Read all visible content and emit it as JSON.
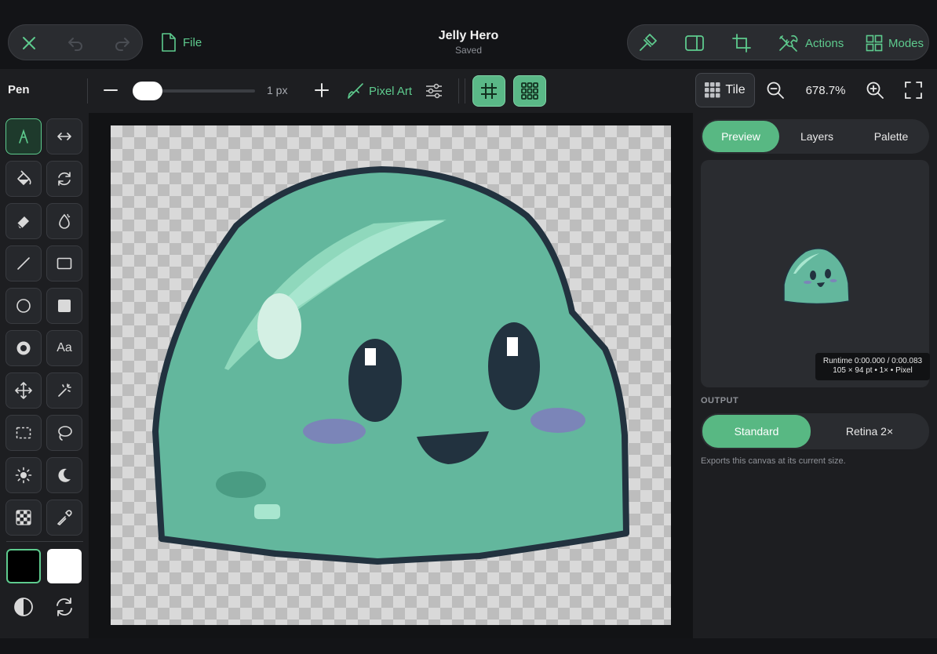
{
  "header": {
    "file_label": "File",
    "doc_title": "Jelly Hero",
    "doc_status": "Saved",
    "actions_label": "Actions",
    "modes_label": "Modes"
  },
  "toolbar": {
    "tool_name": "Pen",
    "brush_size": "1 px",
    "brush_size_value": 1,
    "brush_mode": "Pixel Art",
    "tile_label": "Tile",
    "zoom": "678.7%"
  },
  "tools": [
    "pen-icon",
    "flip-horizontal-icon",
    "fill-bucket-icon",
    "rotate-icon",
    "eraser-icon",
    "blur-drop-icon",
    "line-icon",
    "rectangle-icon",
    "ellipse-icon",
    "filled-square-icon",
    "radial-icon",
    "text-icon",
    "move-icon",
    "magic-wand-icon",
    "marquee-select-icon",
    "lasso-icon",
    "brighten-icon",
    "darken-icon",
    "dither-icon",
    "eyedropper-icon"
  ],
  "text_tool_label": "Aa",
  "colors": {
    "accent": "#5ecb8e",
    "primary_swatch": "#000000",
    "secondary_swatch": "#ffffff",
    "slime_body": "#63b79d",
    "slime_outline": "#22323f"
  },
  "right_panel": {
    "tabs": [
      "Preview",
      "Layers",
      "Palette"
    ],
    "active_tab": "Preview",
    "runtime_line1": "Runtime 0:00.000 / 0:00.083",
    "runtime_line2": "105 × 94 pt • 1× • Pixel",
    "output_heading": "OUTPUT",
    "output_options": [
      "Standard",
      "Retina 2×"
    ],
    "output_selected": "Standard",
    "output_note": "Exports this canvas at its current size."
  }
}
